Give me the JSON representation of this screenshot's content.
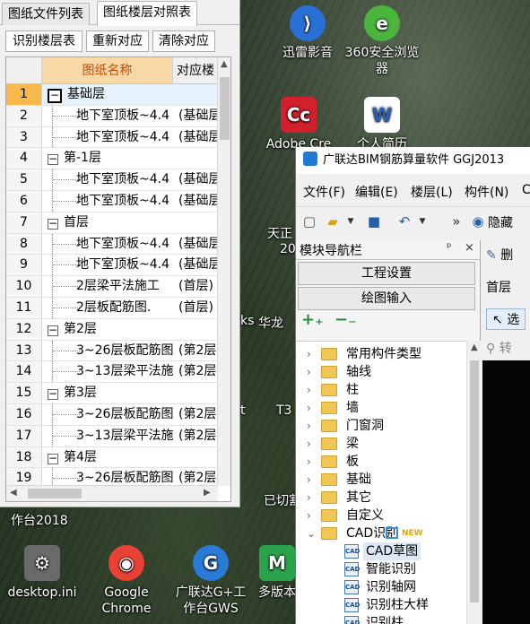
{
  "desktop": {
    "icons": [
      {
        "label": "迅雷影音",
        "color": "#2a6fd6",
        "glyph": "⟩"
      },
      {
        "label": "360安全浏览器",
        "color": "#4ab43c",
        "glyph": "e"
      },
      {
        "label": "Adobe Cre",
        "color": "#d3202e",
        "glyph": "Cc"
      },
      {
        "label": "个人简历",
        "color": "#2b5fb4",
        "glyph": "W"
      },
      {
        "label": "desktop.ini",
        "color": "#6a6a6a",
        "glyph": "⚙"
      },
      {
        "label": "Google Chrome",
        "color": "#e94235",
        "glyph": "◉"
      },
      {
        "label": "广联达G+工作台GWS",
        "color": "#2a7bd8",
        "glyph": "G"
      },
      {
        "label": "多版本",
        "color": "#2ba34a",
        "glyph": "M"
      }
    ],
    "texts": {
      "left_app": "作台2018",
      "tianzheng": "天正",
      "twenty": "20",
      "huawei": "华龙",
      "ks": "ks",
      "t3": "T3",
      "t": "t",
      "yiqie": "已切割"
    }
  },
  "left_panel": {
    "tabs": [
      "图纸文件列表",
      "图纸楼层对照表"
    ],
    "active_tab": 1,
    "buttons": [
      "识别楼层表",
      "重新对应",
      "清除对应"
    ],
    "columns": [
      "图纸名称",
      "对应楼"
    ],
    "rows": [
      {
        "num": "1",
        "type": "group",
        "box": "−",
        "name": "基础层",
        "floor": "",
        "selected": true
      },
      {
        "num": "2",
        "type": "child",
        "name": "地下室顶板~4.4",
        "floor": "(基础层"
      },
      {
        "num": "3",
        "type": "child",
        "name": "地下室顶板~4.4",
        "floor": "(基础层"
      },
      {
        "num": "4",
        "type": "group",
        "box": "−",
        "name": "第-1层",
        "floor": ""
      },
      {
        "num": "5",
        "type": "child",
        "name": "地下室顶板~4.4",
        "floor": "(基础层"
      },
      {
        "num": "6",
        "type": "child",
        "name": "地下室顶板~4.4",
        "floor": "(基础层"
      },
      {
        "num": "7",
        "type": "group",
        "box": "−",
        "name": "首层",
        "floor": ""
      },
      {
        "num": "8",
        "type": "child",
        "name": "地下室顶板~4.4",
        "floor": "(基础层"
      },
      {
        "num": "9",
        "type": "child",
        "name": "地下室顶板~4.4",
        "floor": "(基础层"
      },
      {
        "num": "10",
        "type": "child",
        "name": "2层梁平法施工",
        "floor": "(首层)"
      },
      {
        "num": "11",
        "type": "child",
        "name": "2层板配筋图.",
        "floor": "(首层)"
      },
      {
        "num": "12",
        "type": "group",
        "box": "−",
        "name": "第2层",
        "floor": ""
      },
      {
        "num": "13",
        "type": "child",
        "name": "3~26层板配筋图",
        "floor": "(第2层"
      },
      {
        "num": "14",
        "type": "child",
        "name": "3~13层梁平法施",
        "floor": "(第2层"
      },
      {
        "num": "15",
        "type": "group",
        "box": "−",
        "name": "第3层",
        "floor": ""
      },
      {
        "num": "16",
        "type": "child",
        "name": "3~26层板配筋图",
        "floor": "(第2层"
      },
      {
        "num": "17",
        "type": "child",
        "name": "3~13层梁平法施",
        "floor": "(第2层"
      },
      {
        "num": "18",
        "type": "group",
        "box": "−",
        "name": "第4层",
        "floor": ""
      },
      {
        "num": "19",
        "type": "child",
        "name": "3~26层板配筋图",
        "floor": "(第2层"
      }
    ]
  },
  "app": {
    "title": "广联达BIM钢筋算量软件 GGJ2013",
    "menu": [
      "文件(F)",
      "编辑(E)",
      "楼层(L)",
      "构件(N)",
      "C"
    ],
    "toolbar_hide_label": "隐藏",
    "module_nav": {
      "title": "模块导航栏",
      "pin": "ᵖ",
      "close": "×",
      "buttons": [
        "工程设置",
        "绘图输入"
      ],
      "tree": [
        {
          "label": "常用构件类型",
          "kind": "folder",
          "caret": "›"
        },
        {
          "label": "轴线",
          "kind": "folder",
          "caret": "›"
        },
        {
          "label": "柱",
          "kind": "folder",
          "caret": "›"
        },
        {
          "label": "墙",
          "kind": "folder",
          "caret": "›"
        },
        {
          "label": "门窗洞",
          "kind": "folder",
          "caret": "›"
        },
        {
          "label": "梁",
          "kind": "folder",
          "caret": "›"
        },
        {
          "label": "板",
          "kind": "folder",
          "caret": "›"
        },
        {
          "label": "基础",
          "kind": "folder",
          "caret": "›"
        },
        {
          "label": "其它",
          "kind": "folder",
          "caret": "›"
        },
        {
          "label": "自定义",
          "kind": "folder",
          "caret": "›"
        },
        {
          "label": "CAD识别",
          "kind": "folder-open",
          "caret": "⌄",
          "badge": "NEW"
        },
        {
          "label": "CAD草图",
          "kind": "sub",
          "active": true
        },
        {
          "label": "智能识别",
          "kind": "sub"
        },
        {
          "label": "识别轴网",
          "kind": "sub"
        },
        {
          "label": "识别柱大样",
          "kind": "sub"
        },
        {
          "label": "识别柱",
          "kind": "sub"
        }
      ]
    },
    "right_col": {
      "draw": "删",
      "floor": "首层",
      "select": "选",
      "convert": "转"
    }
  }
}
